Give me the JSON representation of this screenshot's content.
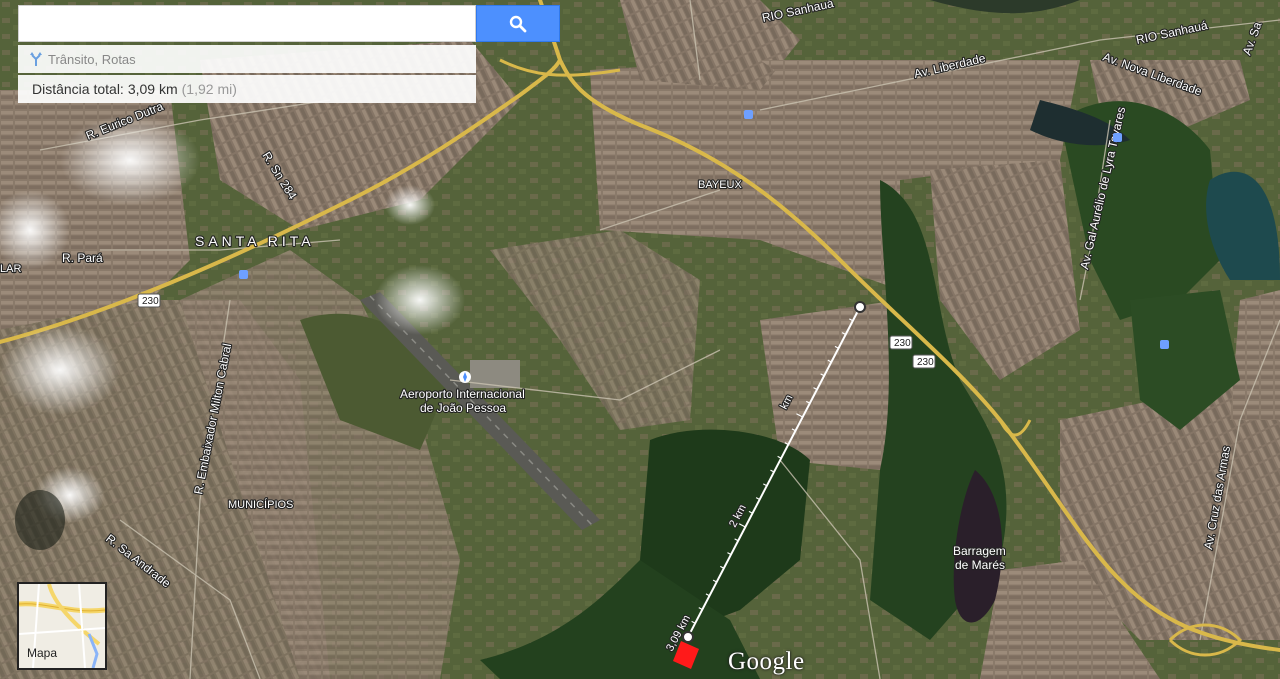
{
  "search": {
    "placeholder": "",
    "value": ""
  },
  "panel": {
    "traffic_routes": "Trânsito, Rotas",
    "distance_label": "Distância total:",
    "distance_km": "3,09 km",
    "distance_mi": "(1,92 mi)"
  },
  "map_labels": {
    "rio_sanhaua_1": "RIO Sanhauá",
    "rio_sanhaua_2": "RIO Sanhauá",
    "av_liberdade": "Av. Liberdade",
    "av_nova_liberdade": "Av. Nova Liberdade",
    "av_santos": "Av. Sa",
    "r_eurico_dutra": "R. Eurico Dutra",
    "r_sn_284": "R. Sn 284",
    "santa_rita": "SANTA RITA",
    "r_para": "R. Pará",
    "lar": "LAR",
    "bayeux": "BAYEUX",
    "aeroporto_1": "Aeroporto Internacional",
    "aeroporto_2": "de João Pessoa",
    "r_embaixador": "R. Embaixador Milton Cabral",
    "municipios": "MUNICÍPIOS",
    "r_sa_andrade": "R. Sa Andrade",
    "av_gal_aurelio": "Av. Gal Aurélio de Lyra Tavares",
    "av_cruz_armas": "Av. Cruz das Armas",
    "barragem_1": "Barragem",
    "barragem_2": "de Marés",
    "shield_230": "230",
    "ruler_2km": "2 km",
    "ruler_km": "km",
    "ruler_end": "3,09 km"
  },
  "map_toggle": {
    "label": "Mapa"
  },
  "logo": "Google",
  "icons": {
    "search": "search-icon",
    "route": "route-fork-icon",
    "airport": "airport-icon"
  },
  "colors": {
    "search_button": "#4d90fe",
    "highway": "#d9b84a",
    "measure_line": "#ffffff",
    "end_marker": "#ff1a1a"
  }
}
